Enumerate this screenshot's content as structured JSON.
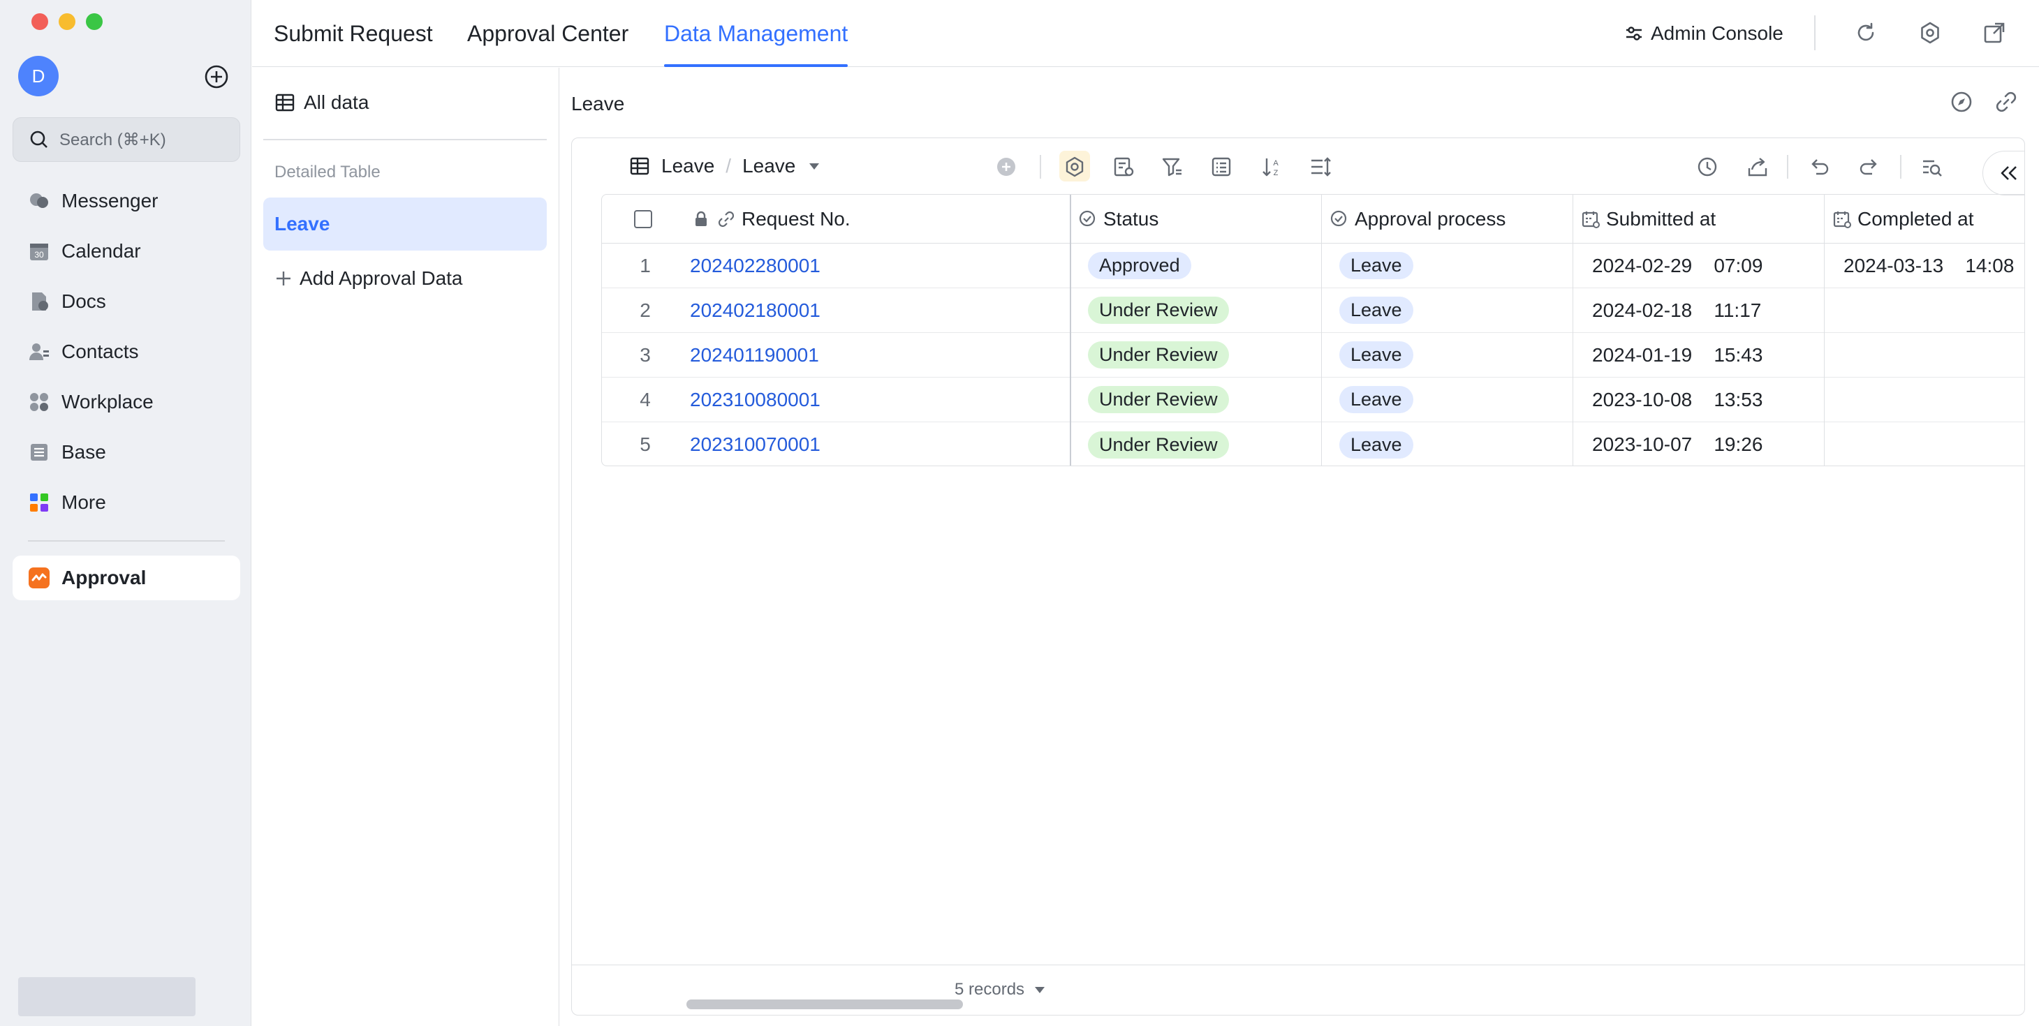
{
  "sidebar": {
    "avatar_initial": "D",
    "search_placeholder": "Search (⌘+K)",
    "items": [
      {
        "label": "Messenger",
        "icon": "messenger-icon"
      },
      {
        "label": "Calendar",
        "icon": "calendar-icon"
      },
      {
        "label": "Docs",
        "icon": "docs-icon"
      },
      {
        "label": "Contacts",
        "icon": "contacts-icon"
      },
      {
        "label": "Workplace",
        "icon": "workplace-icon"
      },
      {
        "label": "Base",
        "icon": "base-icon"
      },
      {
        "label": "More",
        "icon": "more-icon"
      }
    ],
    "active_app": {
      "label": "Approval",
      "icon": "approval-icon",
      "color": "#f5721f"
    }
  },
  "topbar": {
    "tabs": [
      {
        "label": "Submit Request"
      },
      {
        "label": "Approval Center"
      },
      {
        "label": "Data Management",
        "active": true
      }
    ],
    "admin_label": "Admin Console"
  },
  "subnav": {
    "all_data_label": "All data",
    "section_label": "Detailed Table",
    "active_item": "Leave",
    "add_label": "Add Approval Data"
  },
  "main": {
    "title": "Leave",
    "toolbar": {
      "table_name": "Leave",
      "view_name": "Leave"
    },
    "columns": [
      "Request No.",
      "Status",
      "Approval process",
      "Submitted at",
      "Completed at"
    ],
    "rows": [
      {
        "num": "1",
        "request_no": "202402280001",
        "status": "Approved",
        "process": "Leave",
        "submitted": "2024-02-29    07:09",
        "completed": "2024-03-13    14:08"
      },
      {
        "num": "2",
        "request_no": "202402180001",
        "status": "Under Review",
        "process": "Leave",
        "submitted": "2024-02-18    11:17",
        "completed": ""
      },
      {
        "num": "3",
        "request_no": "202401190001",
        "status": "Under Review",
        "process": "Leave",
        "submitted": "2024-01-19    15:43",
        "completed": ""
      },
      {
        "num": "4",
        "request_no": "202310080001",
        "status": "Under Review",
        "process": "Leave",
        "submitted": "2023-10-08    13:53",
        "completed": ""
      },
      {
        "num": "5",
        "request_no": "202310070001",
        "status": "Under Review",
        "process": "Leave",
        "submitted": "2023-10-07    19:26",
        "completed": ""
      }
    ],
    "records_label": "5 records"
  },
  "colors": {
    "accent": "#3370ff",
    "approved_bg": "#e1eaff",
    "review_bg": "#d9f5d6"
  }
}
